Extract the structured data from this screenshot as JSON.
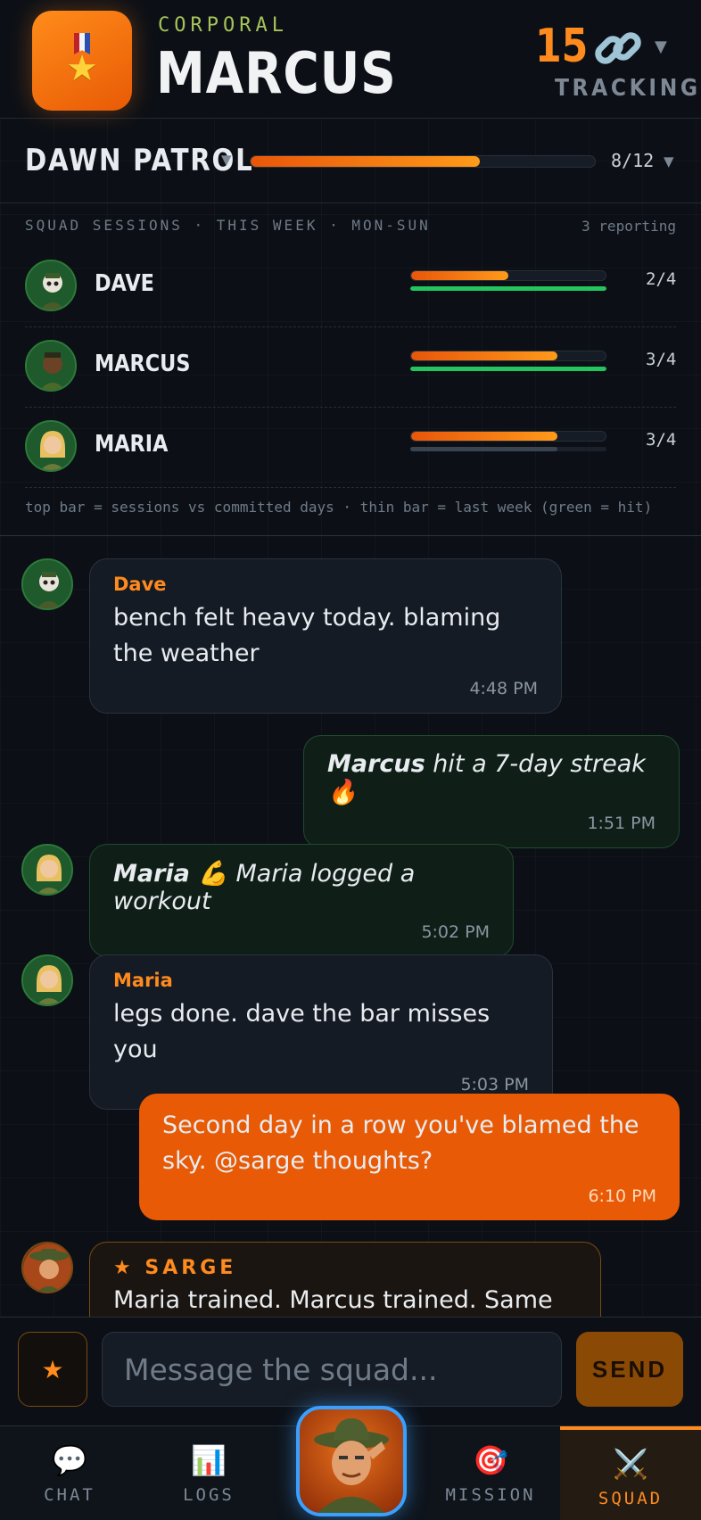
{
  "header": {
    "rank": "CORPORAL",
    "name": "MARCUS",
    "tracking_count": "15",
    "tracking_label": "TRACKING"
  },
  "patrol": {
    "name": "DAWN PATROL",
    "progress_label": "8/12",
    "progress": 0.667
  },
  "sessions": {
    "heading": "SQUAD SESSIONS · THIS WEEK · MON-SUN",
    "reporting": "3 reporting",
    "members": [
      {
        "name": "DAVE",
        "count": "2/4",
        "progress": 0.5,
        "last_week": 1.0,
        "last_week_hit": true
      },
      {
        "name": "MARCUS",
        "count": "3/4",
        "progress": 0.75,
        "last_week": 1.0,
        "last_week_hit": true
      },
      {
        "name": "MARIA",
        "count": "3/4",
        "progress": 0.75,
        "last_week": 0.75,
        "last_week_hit": false
      }
    ],
    "legend": "top bar = sessions vs committed days · thin bar = last week (green = hit)"
  },
  "chat": {
    "messages": [
      {
        "sender": "Dave",
        "text": "bench felt heavy today. blaming the weather",
        "time": "4:48 PM"
      },
      {
        "event_name": "Marcus",
        "event_text": " hit a 7-day streak 🔥",
        "time": "1:51 PM"
      },
      {
        "event_name": "Maria 💪",
        "event_text": " Maria logged a workout",
        "time": "5:02 PM"
      },
      {
        "sender": "Maria",
        "text": "legs done. dave the bar misses you",
        "time": "5:03 PM"
      },
      {
        "text": "Second day in a row you've blamed the sky. @sarge thoughts?",
        "time": "6:10 PM"
      },
      {
        "sender": "★ SARGE",
        "text": "Maria trained. Marcus trained. Same"
      }
    ]
  },
  "composer": {
    "placeholder": "Message the squad...",
    "send_label": "SEND"
  },
  "nav": {
    "chat": "CHAT",
    "logs": "LOGS",
    "mission": "MISSION",
    "squad": "SQUAD"
  },
  "colors": {
    "accent": "#ff8a1e",
    "hit": "#22c55e",
    "miss": "#3a4350",
    "outgoing": "#e85a05"
  },
  "icons": {
    "rank": "medal-icon",
    "tracking": "link-icon",
    "chat": "speech-bubble-icon",
    "logs": "bar-chart-icon",
    "mission": "target-icon",
    "squad": "crossed-swords-icon"
  }
}
